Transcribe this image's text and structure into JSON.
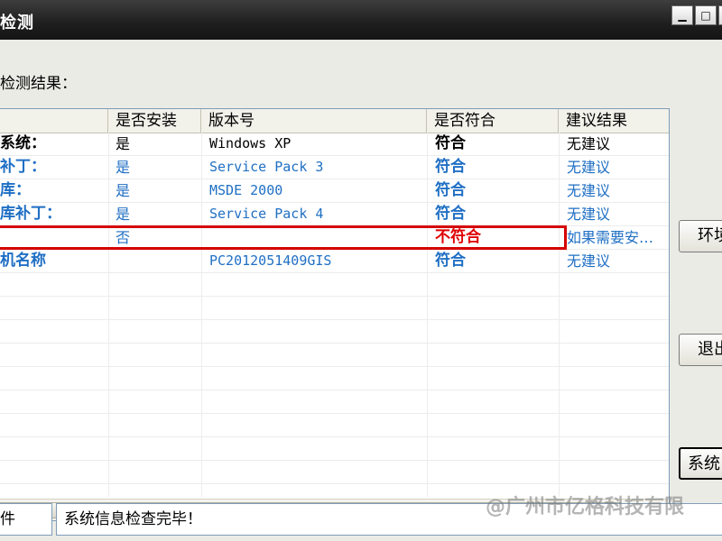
{
  "window": {
    "title": "检测",
    "min": "0",
    "max": "1"
  },
  "section_label": "检测结果：",
  "columns": [
    "",
    "是否安装",
    "版本号",
    "是否符合",
    "建议结果"
  ],
  "rows": [
    {
      "item": "系统：",
      "installed": "是",
      "version": "Windows XP",
      "match": "符合",
      "advice": "无建议"
    },
    {
      "item": "补丁：",
      "installed": "是",
      "version": "Service Pack 3",
      "match": "符合",
      "advice": "无建议"
    },
    {
      "item": "库：",
      "installed": "是",
      "version": "MSDE 2000",
      "match": "符合",
      "advice": "无建议"
    },
    {
      "item": "库补丁：",
      "installed": "是",
      "version": "Service Pack 4",
      "match": "符合",
      "advice": "无建议"
    },
    {
      "item": "",
      "installed": "否",
      "version": "",
      "match": "不符合",
      "advice": "如果需要安…"
    },
    {
      "item": "机名称",
      "installed": "",
      "version": "PC2012051409GIS",
      "match": "符合",
      "advice": "无建议"
    }
  ],
  "scrollbar": {
    "grip": "|||",
    "right_arrow": "▶"
  },
  "buttons": {
    "env": "环境",
    "exit": "退出",
    "sys": "系统"
  },
  "status": {
    "left": "件",
    "message": "系统信息检查完毕！"
  },
  "watermark": "@广州市亿格科技有限"
}
